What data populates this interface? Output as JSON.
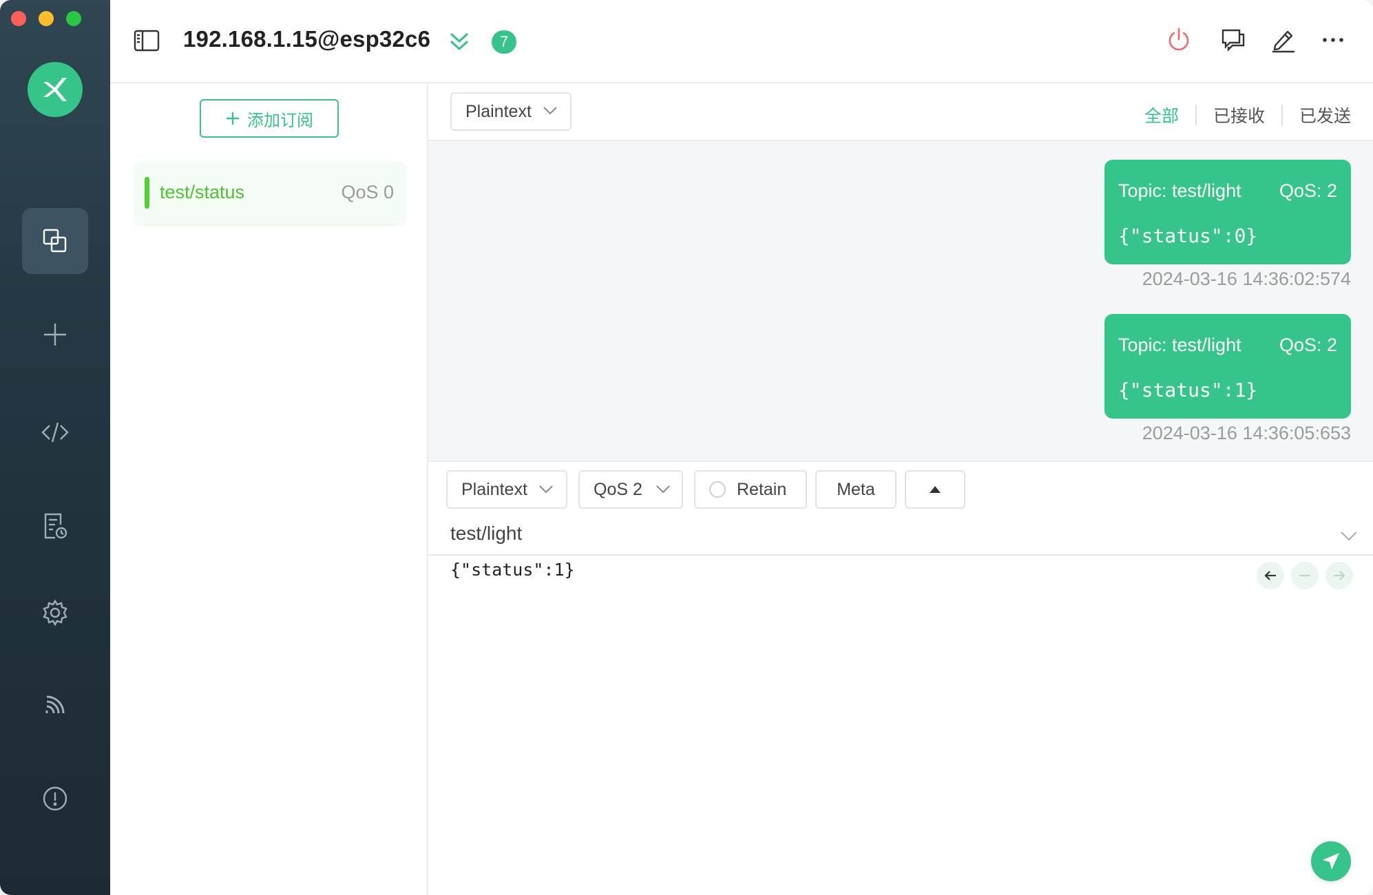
{
  "connection": {
    "title": "192.168.1.15@esp32c6",
    "unread_count": "7"
  },
  "subscriptions": {
    "add_label": "添加订阅",
    "items": [
      {
        "topic": "test/status",
        "qos": "QoS 0",
        "color": "#4fd22b"
      }
    ]
  },
  "message_view": {
    "format": "Plaintext",
    "filters": {
      "all": "全部",
      "received": "已接收",
      "sent": "已发送"
    },
    "messages": [
      {
        "topic": "Topic: test/light",
        "qos": "QoS: 2",
        "payload": "{\"status\":0}",
        "time": "2024-03-16 14:36:02:574"
      },
      {
        "topic": "Topic: test/light",
        "qos": "QoS: 2",
        "payload": "{\"status\":1}",
        "time": "2024-03-16 14:36:05:653"
      }
    ]
  },
  "publish": {
    "format": "Plaintext",
    "qos": "QoS 2",
    "retain_label": "Retain",
    "meta_label": "Meta",
    "topic": "test/light",
    "payload": "{\"status\":1}"
  },
  "colors": {
    "accent": "#35c48a",
    "sidebar": "#233641",
    "subscription": "#4fd22b"
  },
  "icons": {
    "sidebar": [
      "connections-icon",
      "plus-icon",
      "code-icon",
      "log-icon",
      "gear-icon",
      "rss-icon",
      "info-icon"
    ],
    "topbar": [
      "sidebar-toggle-icon",
      "double-chevron-down-icon",
      "power-icon",
      "chat-icon",
      "edit-icon",
      "more-icon"
    ]
  }
}
